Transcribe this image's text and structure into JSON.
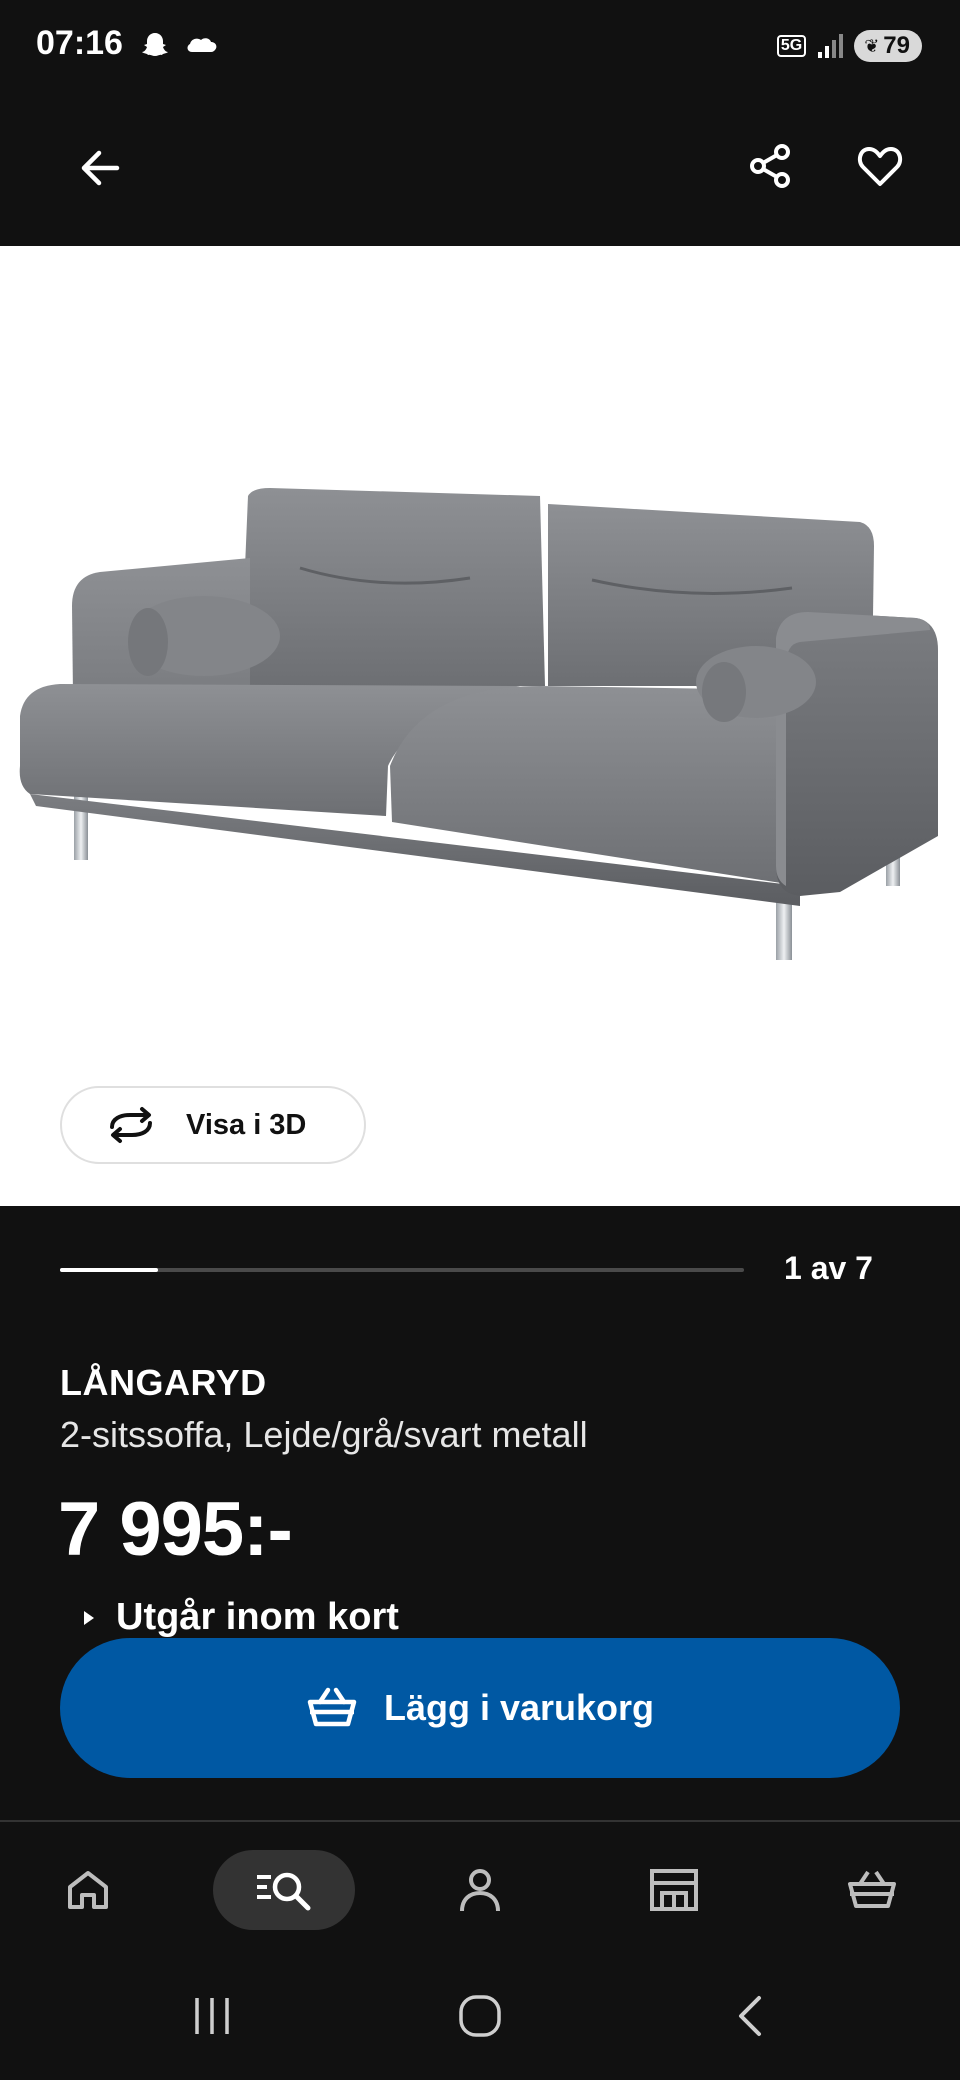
{
  "status_bar": {
    "time": "07:16",
    "left_icons": [
      "snapchat-icon",
      "klarna-icon"
    ],
    "network": "5G",
    "battery": "79"
  },
  "top_bar": {
    "back_icon": "arrow-left-icon",
    "share_icon": "share-icon",
    "favorite_icon": "heart-icon"
  },
  "gallery": {
    "view_3d_label": "Visa i 3D",
    "pager": "1 av 7",
    "current_index": 1,
    "total": 7
  },
  "product": {
    "name": "LÅNGARYD",
    "description": "2-sitssoffa, Lejde/grå/svart metall",
    "price": "7 995:-",
    "availability": "Utgår inom kort"
  },
  "cta": {
    "add_to_cart_label": "Lägg i varukorg"
  },
  "bottom_nav": {
    "items": [
      {
        "name": "home",
        "icon": "home-icon",
        "active": false
      },
      {
        "name": "search",
        "icon": "search-icon",
        "active": true
      },
      {
        "name": "profile",
        "icon": "person-icon",
        "active": false
      },
      {
        "name": "store",
        "icon": "store-icon",
        "active": false
      },
      {
        "name": "cart",
        "icon": "basket-icon",
        "active": false
      }
    ]
  },
  "colors": {
    "background": "#111111",
    "primary_blue": "#0058a3",
    "white": "#ffffff"
  }
}
